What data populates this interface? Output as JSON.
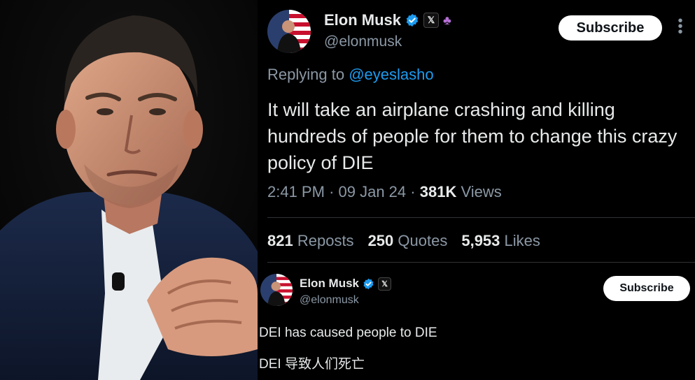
{
  "tweet": {
    "author": {
      "name": "Elon Musk",
      "handle": "@elonmusk"
    },
    "subscribe_label": "Subscribe",
    "more_label": "⋮",
    "reply": {
      "prefix": "Replying to",
      "mention": "@eyeslasho"
    },
    "text": "It will take an airplane crashing and killing hundreds of people for them to change this crazy policy of DIE",
    "meta": {
      "time": "2:41 PM",
      "sep": "·",
      "date": "09 Jan 24",
      "views_count": "381K",
      "views_label": "Views"
    },
    "stats": [
      {
        "count": "821",
        "label": "Reposts"
      },
      {
        "count": "250",
        "label": "Quotes"
      },
      {
        "count": "5,953",
        "label": "Likes"
      }
    ]
  },
  "second_post": {
    "author": {
      "name": "Elon Musk",
      "handle": "@elonmusk"
    },
    "subscribe_label": "Subscribe",
    "line1": "DEI has caused people to DIE",
    "line2": "DEI 导致人们死亡"
  },
  "icons": {
    "verified": "verified-check-icon",
    "x_badge": "x-logo-icon",
    "affiliation": "affiliation-badge-icon"
  },
  "colors": {
    "background": "#000000",
    "text": "#e7e9ea",
    "secondary": "#8b98a5",
    "accent": "#1d9bf0",
    "button": "#ffffff"
  }
}
